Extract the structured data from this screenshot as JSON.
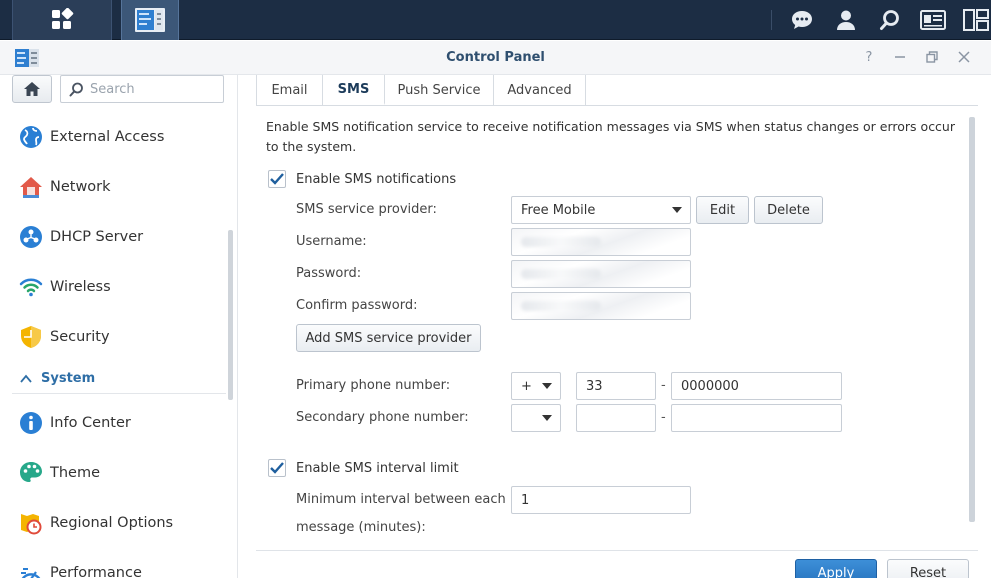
{
  "window": {
    "title": "Control Panel"
  },
  "taskbar": {
    "icons": [
      "main-menu-icon",
      "control-panel-app-icon",
      "chat-icon",
      "user-icon",
      "search-icon",
      "widgets-icon",
      "window-layout-icon"
    ]
  },
  "sidebar": {
    "search_placeholder": "Search",
    "items": [
      {
        "label": "External Access",
        "icon": "globe-icon"
      },
      {
        "label": "Network",
        "icon": "house-network-icon"
      },
      {
        "label": "DHCP Server",
        "icon": "dhcp-icon"
      },
      {
        "label": "Wireless",
        "icon": "wifi-icon"
      },
      {
        "label": "Security",
        "icon": "shield-icon"
      }
    ],
    "category": "System",
    "system_items": [
      {
        "label": "Info Center",
        "icon": "info-icon"
      },
      {
        "label": "Theme",
        "icon": "palette-icon"
      },
      {
        "label": "Regional Options",
        "icon": "regional-clock-icon"
      },
      {
        "label": "Performance",
        "icon": "performance-icon"
      }
    ]
  },
  "tabs": [
    {
      "label": "Email",
      "active": false
    },
    {
      "label": "SMS",
      "active": true
    },
    {
      "label": "Push Service",
      "active": false
    },
    {
      "label": "Advanced",
      "active": false
    }
  ],
  "sms": {
    "description": "Enable SMS notification service to receive notification messages via SMS when status changes or errors occur to the system.",
    "enable_label": "Enable SMS notifications",
    "provider_label": "SMS service provider:",
    "provider_value": "Free Mobile",
    "edit_label": "Edit",
    "delete_label": "Delete",
    "username_label": "Username:",
    "password_label": "Password:",
    "confirm_label": "Confirm password:",
    "add_provider_label": "Add SMS service provider",
    "primary_label": "Primary phone number:",
    "primary_prefix": "+",
    "primary_country": "33",
    "primary_number": "0000000",
    "secondary_label": "Secondary phone number:",
    "secondary_prefix": "",
    "secondary_country": "",
    "secondary_number": "",
    "dash": "-",
    "interval_enable_label": "Enable SMS interval limit",
    "interval_label_line1": "Minimum interval between each",
    "interval_label_line2": "message (minutes):",
    "interval_value": "1"
  },
  "footer": {
    "apply_label": "Apply",
    "reset_label": "Reset"
  },
  "colors": {
    "taskbar": "#1c2d44",
    "accent": "#2e6ea6",
    "apply": "#2a78c5"
  }
}
